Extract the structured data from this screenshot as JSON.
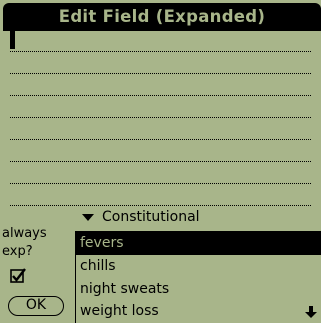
{
  "app": {
    "title": "Edit Field (Expanded)"
  },
  "category_popup": {
    "label": "Constitutional"
  },
  "options": {
    "always_label": "always exp?",
    "checkbox_checked": true
  },
  "ok_button": {
    "label": "OK"
  },
  "list": {
    "items": [
      {
        "label": "fevers",
        "selected": true
      },
      {
        "label": "chills",
        "selected": false
      },
      {
        "label": "night sweats",
        "selected": false
      },
      {
        "label": "weight loss",
        "selected": false
      }
    ]
  },
  "colors": {
    "screen": "#a8b58a",
    "ink": "#000000"
  }
}
